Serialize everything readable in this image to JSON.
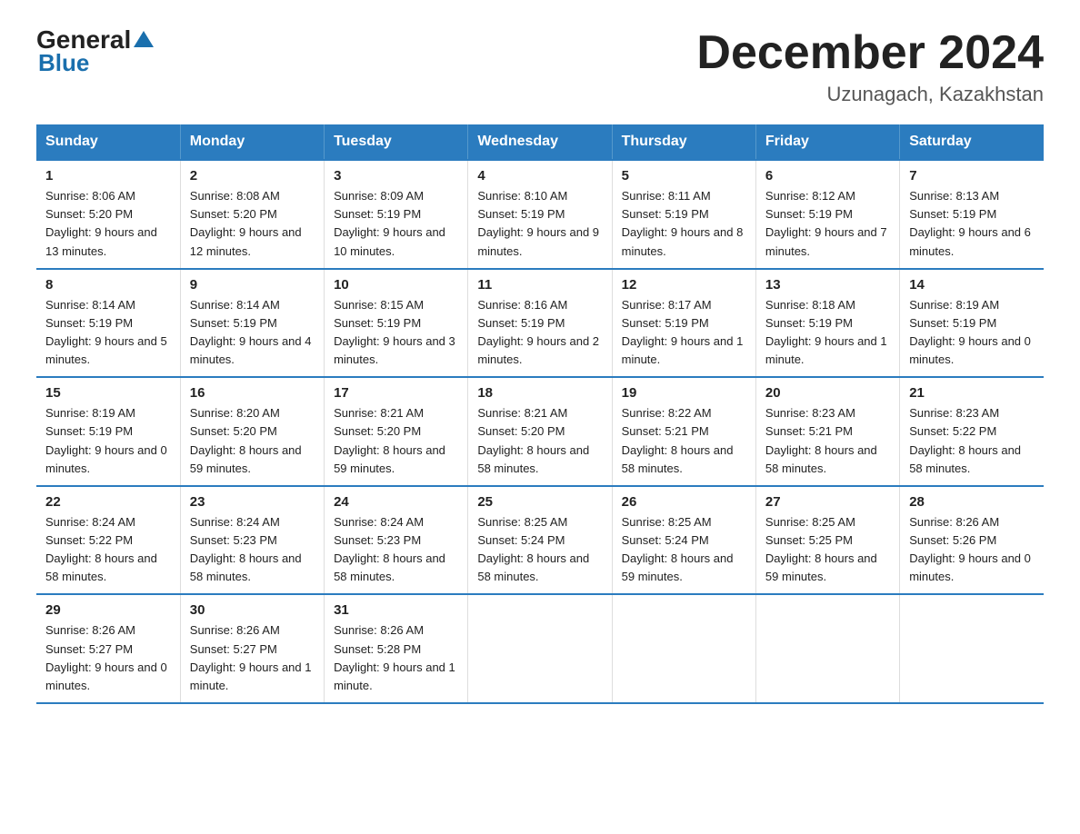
{
  "header": {
    "logo_general": "General",
    "logo_blue": "Blue",
    "month_title": "December 2024",
    "location": "Uzunagach, Kazakhstan"
  },
  "weekdays": [
    "Sunday",
    "Monday",
    "Tuesday",
    "Wednesday",
    "Thursday",
    "Friday",
    "Saturday"
  ],
  "weeks": [
    [
      {
        "day": "1",
        "sunrise": "8:06 AM",
        "sunset": "5:20 PM",
        "daylight": "9 hours and 13 minutes."
      },
      {
        "day": "2",
        "sunrise": "8:08 AM",
        "sunset": "5:20 PM",
        "daylight": "9 hours and 12 minutes."
      },
      {
        "day": "3",
        "sunrise": "8:09 AM",
        "sunset": "5:19 PM",
        "daylight": "9 hours and 10 minutes."
      },
      {
        "day": "4",
        "sunrise": "8:10 AM",
        "sunset": "5:19 PM",
        "daylight": "9 hours and 9 minutes."
      },
      {
        "day": "5",
        "sunrise": "8:11 AM",
        "sunset": "5:19 PM",
        "daylight": "9 hours and 8 minutes."
      },
      {
        "day": "6",
        "sunrise": "8:12 AM",
        "sunset": "5:19 PM",
        "daylight": "9 hours and 7 minutes."
      },
      {
        "day": "7",
        "sunrise": "8:13 AM",
        "sunset": "5:19 PM",
        "daylight": "9 hours and 6 minutes."
      }
    ],
    [
      {
        "day": "8",
        "sunrise": "8:14 AM",
        "sunset": "5:19 PM",
        "daylight": "9 hours and 5 minutes."
      },
      {
        "day": "9",
        "sunrise": "8:14 AM",
        "sunset": "5:19 PM",
        "daylight": "9 hours and 4 minutes."
      },
      {
        "day": "10",
        "sunrise": "8:15 AM",
        "sunset": "5:19 PM",
        "daylight": "9 hours and 3 minutes."
      },
      {
        "day": "11",
        "sunrise": "8:16 AM",
        "sunset": "5:19 PM",
        "daylight": "9 hours and 2 minutes."
      },
      {
        "day": "12",
        "sunrise": "8:17 AM",
        "sunset": "5:19 PM",
        "daylight": "9 hours and 1 minute."
      },
      {
        "day": "13",
        "sunrise": "8:18 AM",
        "sunset": "5:19 PM",
        "daylight": "9 hours and 1 minute."
      },
      {
        "day": "14",
        "sunrise": "8:19 AM",
        "sunset": "5:19 PM",
        "daylight": "9 hours and 0 minutes."
      }
    ],
    [
      {
        "day": "15",
        "sunrise": "8:19 AM",
        "sunset": "5:19 PM",
        "daylight": "9 hours and 0 minutes."
      },
      {
        "day": "16",
        "sunrise": "8:20 AM",
        "sunset": "5:20 PM",
        "daylight": "8 hours and 59 minutes."
      },
      {
        "day": "17",
        "sunrise": "8:21 AM",
        "sunset": "5:20 PM",
        "daylight": "8 hours and 59 minutes."
      },
      {
        "day": "18",
        "sunrise": "8:21 AM",
        "sunset": "5:20 PM",
        "daylight": "8 hours and 58 minutes."
      },
      {
        "day": "19",
        "sunrise": "8:22 AM",
        "sunset": "5:21 PM",
        "daylight": "8 hours and 58 minutes."
      },
      {
        "day": "20",
        "sunrise": "8:23 AM",
        "sunset": "5:21 PM",
        "daylight": "8 hours and 58 minutes."
      },
      {
        "day": "21",
        "sunrise": "8:23 AM",
        "sunset": "5:22 PM",
        "daylight": "8 hours and 58 minutes."
      }
    ],
    [
      {
        "day": "22",
        "sunrise": "8:24 AM",
        "sunset": "5:22 PM",
        "daylight": "8 hours and 58 minutes."
      },
      {
        "day": "23",
        "sunrise": "8:24 AM",
        "sunset": "5:23 PM",
        "daylight": "8 hours and 58 minutes."
      },
      {
        "day": "24",
        "sunrise": "8:24 AM",
        "sunset": "5:23 PM",
        "daylight": "8 hours and 58 minutes."
      },
      {
        "day": "25",
        "sunrise": "8:25 AM",
        "sunset": "5:24 PM",
        "daylight": "8 hours and 58 minutes."
      },
      {
        "day": "26",
        "sunrise": "8:25 AM",
        "sunset": "5:24 PM",
        "daylight": "8 hours and 59 minutes."
      },
      {
        "day": "27",
        "sunrise": "8:25 AM",
        "sunset": "5:25 PM",
        "daylight": "8 hours and 59 minutes."
      },
      {
        "day": "28",
        "sunrise": "8:26 AM",
        "sunset": "5:26 PM",
        "daylight": "9 hours and 0 minutes."
      }
    ],
    [
      {
        "day": "29",
        "sunrise": "8:26 AM",
        "sunset": "5:27 PM",
        "daylight": "9 hours and 0 minutes."
      },
      {
        "day": "30",
        "sunrise": "8:26 AM",
        "sunset": "5:27 PM",
        "daylight": "9 hours and 1 minute."
      },
      {
        "day": "31",
        "sunrise": "8:26 AM",
        "sunset": "5:28 PM",
        "daylight": "9 hours and 1 minute."
      },
      null,
      null,
      null,
      null
    ]
  ]
}
